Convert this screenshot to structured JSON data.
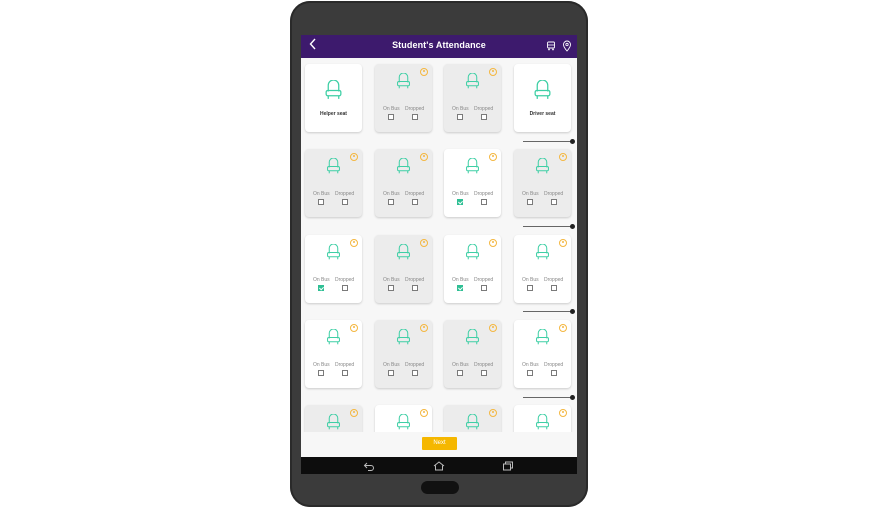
{
  "app": {
    "title": "Student's Attendance"
  },
  "labels": {
    "on_bus": "On Bus",
    "dropped": "Dropped"
  },
  "footer": {
    "next_label": "Next"
  },
  "colors": {
    "appbar": "#3d1a6d",
    "seat_icon": "#3ecfa5",
    "person_icon": "#f4b740",
    "checkbox_checked": "#2fbf94",
    "next_button": "#f5b700"
  },
  "icons": {
    "back": "chevron-left-icon",
    "bus": "bus-icon",
    "location": "location-pin-icon",
    "nav_back": "nav-back-icon",
    "nav_home": "nav-home-icon",
    "nav_recent": "nav-recent-apps-icon"
  },
  "rows": [
    [
      {
        "type": "special",
        "label": "Helper seat"
      },
      {
        "type": "seat",
        "occupied": false,
        "on_bus": false,
        "dropped": false
      },
      {
        "type": "seat",
        "occupied": false,
        "on_bus": false,
        "dropped": false
      },
      {
        "type": "special",
        "label": "Driver seat"
      }
    ],
    [
      {
        "type": "seat",
        "occupied": false,
        "on_bus": false,
        "dropped": false
      },
      {
        "type": "seat",
        "occupied": false,
        "on_bus": false,
        "dropped": false
      },
      {
        "type": "seat",
        "occupied": true,
        "on_bus": true,
        "dropped": false
      },
      {
        "type": "seat",
        "occupied": false,
        "on_bus": false,
        "dropped": false
      }
    ],
    [
      {
        "type": "seat",
        "occupied": true,
        "on_bus": true,
        "dropped": false
      },
      {
        "type": "seat",
        "occupied": false,
        "on_bus": false,
        "dropped": false
      },
      {
        "type": "seat",
        "occupied": true,
        "on_bus": true,
        "dropped": false
      },
      {
        "type": "seat",
        "occupied": true,
        "on_bus": false,
        "dropped": false
      }
    ],
    [
      {
        "type": "seat",
        "occupied": true,
        "on_bus": false,
        "dropped": false
      },
      {
        "type": "seat",
        "occupied": false,
        "on_bus": false,
        "dropped": false
      },
      {
        "type": "seat",
        "occupied": false,
        "on_bus": false,
        "dropped": false
      },
      {
        "type": "seat",
        "occupied": true,
        "on_bus": false,
        "dropped": false
      }
    ],
    [
      {
        "type": "seat",
        "occupied": false,
        "on_bus": false,
        "dropped": false
      },
      {
        "type": "seat",
        "occupied": true,
        "on_bus": false,
        "dropped": false
      },
      {
        "type": "seat",
        "occupied": false,
        "on_bus": false,
        "dropped": false
      },
      {
        "type": "seat",
        "occupied": true,
        "on_bus": false,
        "dropped": false
      }
    ]
  ]
}
